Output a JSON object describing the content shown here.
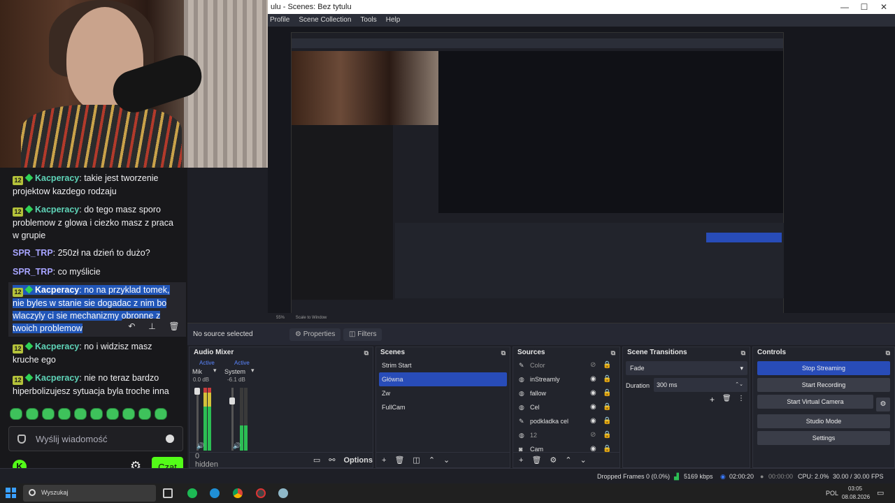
{
  "chat": {
    "messages": [
      {
        "badge": "12",
        "user": "Kacperacy",
        "text": "takie jest tworzenie projektow kazdego rodzaju"
      },
      {
        "badge": "12",
        "user": "Kacperacy",
        "text": "do tego masz sporo problemow z glowa i ciezko masz z praca w grupie"
      },
      {
        "user": "SPR_TRP",
        "text": "250zł na dzień to dużo?"
      },
      {
        "user": "SPR_TRP",
        "text": "co myślicie"
      },
      {
        "badge": "12",
        "user": "Kacperacy",
        "text": "no na przyklad tomek, nie byles w stanie sie dogadac z nim bo wlaczyly ci sie mechanizmy obronne z twoich problemow"
      },
      {
        "badge": "12",
        "user": "Kacperacy",
        "text": "no i widzisz masz kruche ego"
      },
      {
        "badge": "12",
        "user": "Kacperacy",
        "text": "nie no teraz bardzo hiperbolizujesz sytuacja byla troche inna"
      }
    ],
    "input_placeholder": "Wyślij wiadomość",
    "send_label": "Czat",
    "colors": {
      "kick_green": "#53fc18",
      "user_kacperacy": "#5fd4b8",
      "user_spr": "#a7a4ff"
    }
  },
  "obs": {
    "window_title": "ulu - Scenes: Bez tytulu",
    "menu": [
      "Profile",
      "Scene Collection",
      "Tools",
      "Help"
    ],
    "preview": {
      "zoom": "55%",
      "scale_mode": "Scale to Window"
    },
    "source_bar": {
      "label": "No source selected",
      "properties": "Properties",
      "filters": "Filters"
    },
    "audio_mixer": {
      "title": "Audio Mixer",
      "channels": [
        {
          "name": "Mik",
          "level": "0.0 dB",
          "state": "Active"
        },
        {
          "name": "System",
          "level": "-6.1 dB",
          "state": "Active"
        }
      ],
      "scale": [
        "6",
        "0",
        "-6",
        "-12",
        "-18",
        "-24",
        "-30",
        "-36",
        "-42",
        "-48",
        "-54",
        "-60"
      ],
      "hidden": "0 hidden",
      "options": "Options"
    },
    "scenes": {
      "title": "Scenes",
      "items": [
        "Strim Start",
        "Główna",
        "Zw",
        "FullCam"
      ],
      "selected": 1
    },
    "sources": {
      "title": "Sources",
      "items": [
        {
          "name": "Color",
          "icon": "brush-icon"
        },
        {
          "name": "inStreamly",
          "icon": "globe-icon"
        },
        {
          "name": "fallow",
          "icon": "globe-icon"
        },
        {
          "name": "Cel",
          "icon": "globe-icon"
        },
        {
          "name": "podkladka cel",
          "icon": "brush-icon"
        },
        {
          "name": "12",
          "icon": "globe-icon"
        },
        {
          "name": "Cam",
          "icon": "camera-icon"
        }
      ]
    },
    "transitions": {
      "title": "Scene Transitions",
      "type": "Fade",
      "duration_label": "Duration",
      "duration_value": "300 ms"
    },
    "controls": {
      "title": "Controls",
      "buttons": [
        "Stop Streaming",
        "Start Recording",
        "Start Virtual Camera",
        "Studio Mode",
        "Settings"
      ]
    },
    "status": {
      "dropped": "Dropped Frames 0 (0.0%)",
      "bitrate": "5169 kbps",
      "stream_time": "02:00:20",
      "rec_time": "00:00:00",
      "cpu": "CPU: 2.0%",
      "fps": "30.00 / 30.00 FPS"
    }
  },
  "taskbar": {
    "search": "Wyszukaj",
    "lang": "POL",
    "time": "03:05",
    "date": "08.08.2026"
  }
}
